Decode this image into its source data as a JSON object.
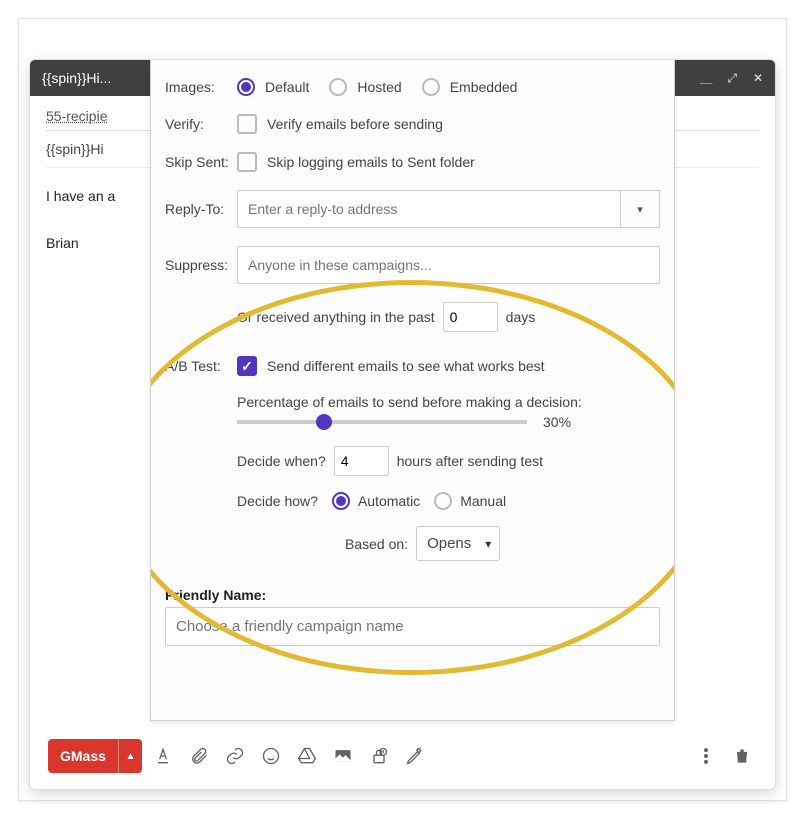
{
  "compose": {
    "title": "{{spin}}Hi...",
    "recipients": "55-recipie",
    "subject": "{{spin}}Hi",
    "body_line1": "I have an a",
    "body_line2": "Brian"
  },
  "settings": {
    "images": {
      "label": "Images:",
      "options": {
        "default": "Default",
        "hosted": "Hosted",
        "embedded": "Embedded"
      },
      "selected": "default"
    },
    "verify": {
      "label": "Verify:",
      "text": "Verify emails before sending",
      "checked": false
    },
    "skip_sent": {
      "label": "Skip Sent:",
      "text": "Skip logging emails to Sent folder",
      "checked": false
    },
    "reply_to": {
      "label": "Reply-To:",
      "placeholder": "Enter a reply-to address",
      "value": ""
    },
    "suppress": {
      "label": "Suppress:",
      "placeholder": "Anyone in these campaigns...",
      "or_text_pre": "Or received anything in the past",
      "days_value": "0",
      "or_text_post": "days"
    },
    "ab_test": {
      "label": "A/B Test:",
      "checked": true,
      "text": "Send different emails to see what works best",
      "percent_label": "Percentage of emails to send before making a decision:",
      "percent_value": 30,
      "percent_display": "30%",
      "decide_when_label": "Decide when?",
      "decide_when_value": "4",
      "decide_when_suffix": "hours after sending test",
      "decide_how_label": "Decide how?",
      "decide_how_options": {
        "automatic": "Automatic",
        "manual": "Manual"
      },
      "decide_how_selected": "automatic",
      "based_on_label": "Based on:",
      "based_on_value": "Opens"
    },
    "friendly": {
      "label": "Friendly Name:",
      "placeholder": "Choose a friendly campaign name",
      "value": ""
    }
  },
  "toolbar": {
    "gmass": "GMass"
  }
}
